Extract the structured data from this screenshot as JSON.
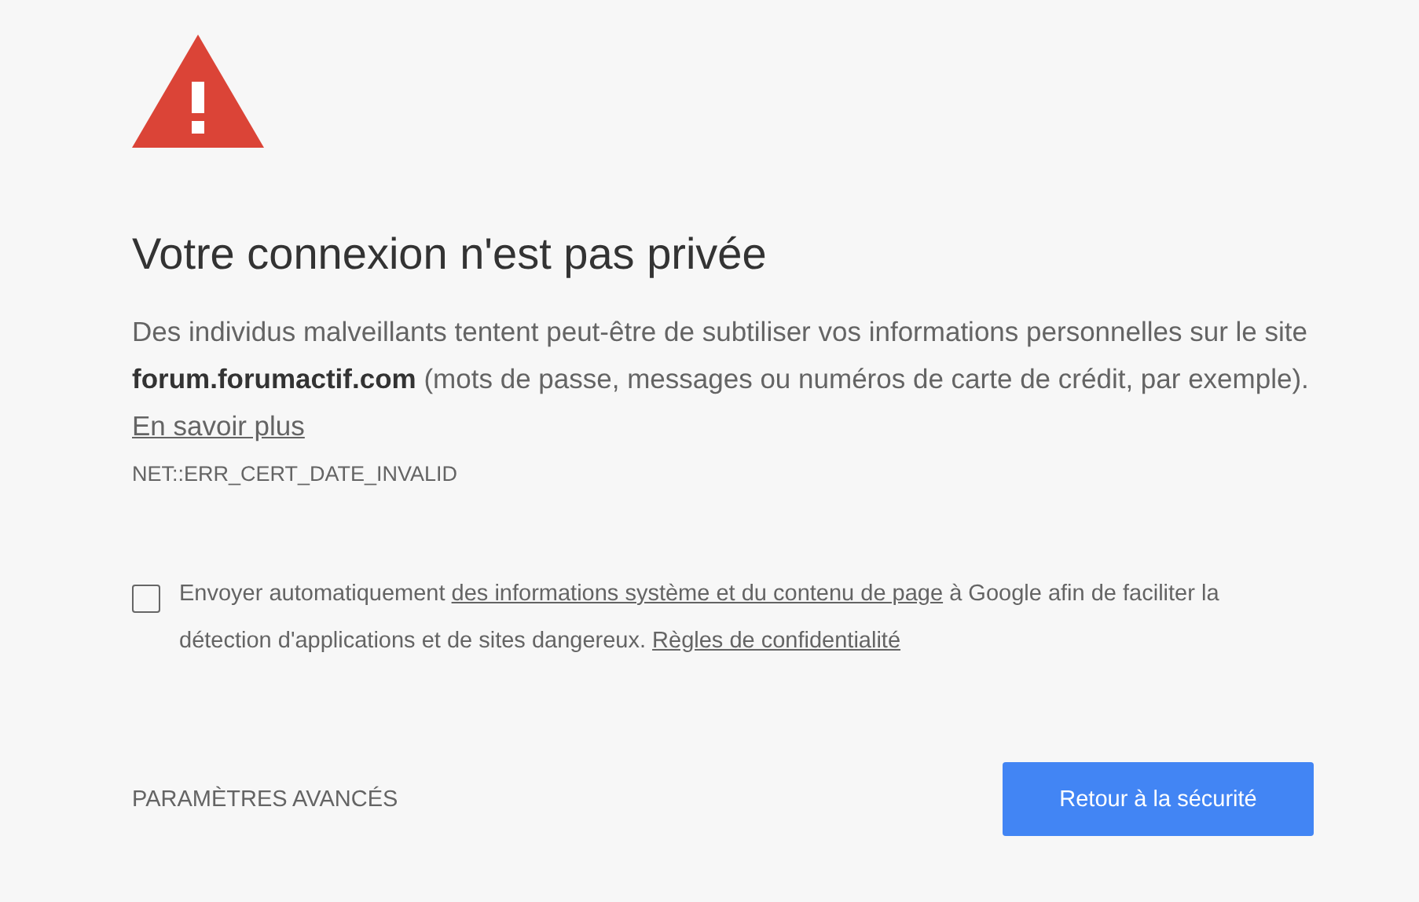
{
  "title": "Votre connexion n'est pas privée",
  "description": {
    "text": "Des individus malveillants tentent peut-être de subtiliser vos informations personnelles sur le site **forum.forumactif.com** (mots de passe, messages ou numéros de carte de crédit, par exemple).",
    "link": "En savoir plus"
  },
  "error_code": "NET::ERR_CERT_DATE_INVALID",
  "report": {
    "checked": false,
    "parts": [
      {
        "kind": "text",
        "text": "Envoyer automatiquement"
      },
      {
        "kind": "link",
        "text": "des informations système et du contenu de page"
      },
      {
        "kind": "text",
        "text": "à Google afin de faciliter la détection d'applications et de sites dangereux."
      },
      {
        "kind": "link",
        "text": "Règles de confidentialité"
      }
    ]
  },
  "advanced_button": "PARAMÈTRES AVANCÉS",
  "back_button": "Retour à la sécurité"
}
